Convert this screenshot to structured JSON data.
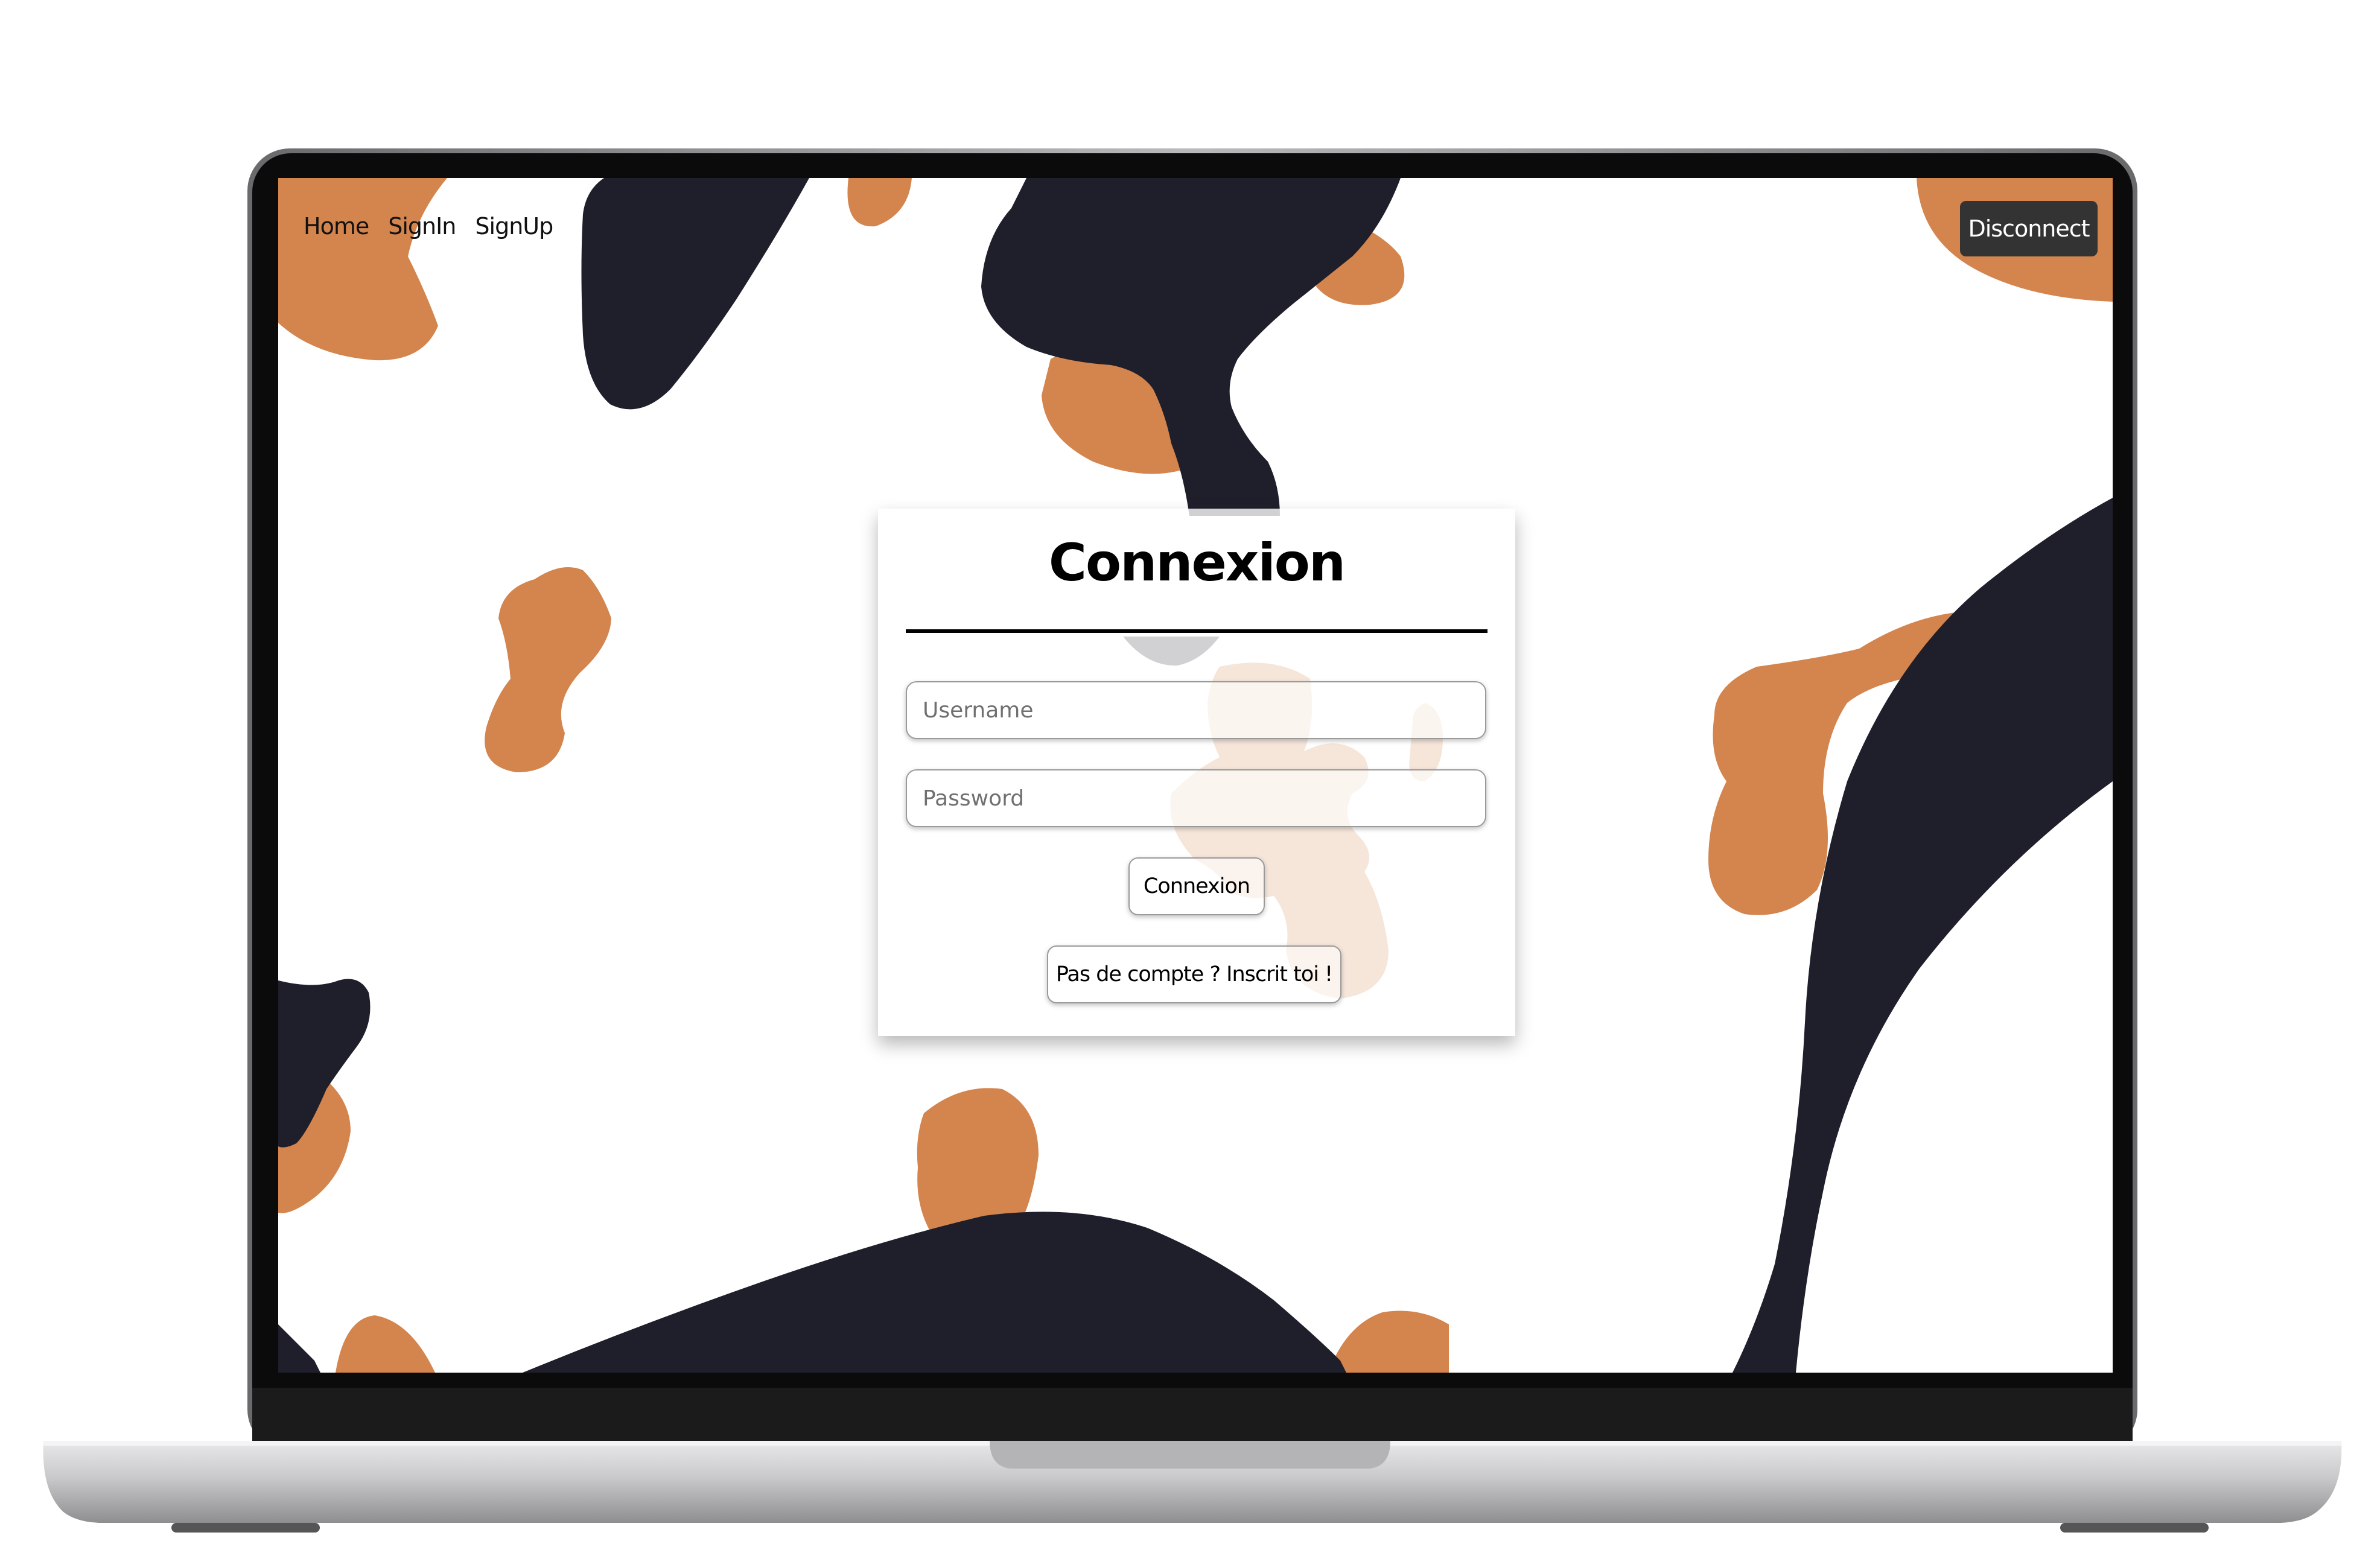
{
  "nav": {
    "home": "Home",
    "signin": "SignIn",
    "signup": "SignUp",
    "disconnect": "Disconnect"
  },
  "login": {
    "title": "Connexion",
    "username_placeholder": "Username",
    "password_placeholder": "Password",
    "submit_label": "Connexion",
    "signup_prompt": "Pas de compte ? Inscrit toi !"
  },
  "colors": {
    "orange": "#D4844D",
    "navy": "#1E1F2B",
    "button_dark": "#333333"
  }
}
